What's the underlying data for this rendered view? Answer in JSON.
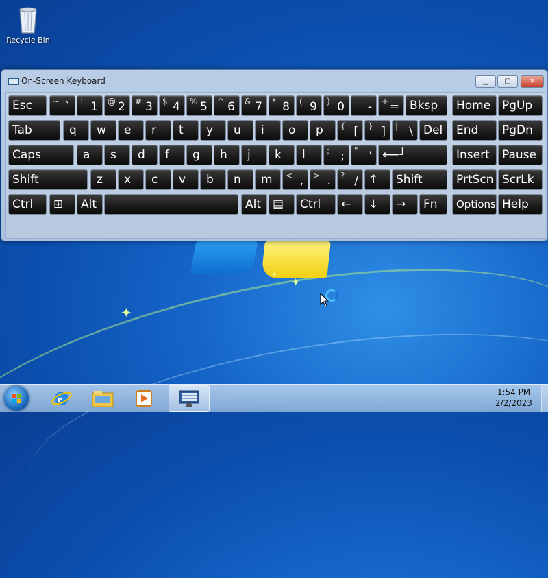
{
  "desktop": {
    "recycle_bin_label": "Recycle Bin"
  },
  "osk": {
    "title": "On-Screen Keyboard",
    "row1": [
      {
        "main": "Esc"
      },
      {
        "sym": "~",
        "ch": "`"
      },
      {
        "sym": "!",
        "ch": "1"
      },
      {
        "sym": "@",
        "ch": "2"
      },
      {
        "sym": "#",
        "ch": "3"
      },
      {
        "sym": "$",
        "ch": "4"
      },
      {
        "sym": "%",
        "ch": "5"
      },
      {
        "sym": "^",
        "ch": "6"
      },
      {
        "sym": "&",
        "ch": "7"
      },
      {
        "sym": "*",
        "ch": "8"
      },
      {
        "sym": "(",
        "ch": "9"
      },
      {
        "sym": ")",
        "ch": "0"
      },
      {
        "sym": "_",
        "ch": "-"
      },
      {
        "sym": "+",
        "ch": "="
      },
      {
        "main": "Bksp"
      },
      {
        "main": "Home"
      },
      {
        "main": "PgUp"
      }
    ],
    "row2": [
      {
        "main": "Tab"
      },
      {
        "main": "q"
      },
      {
        "main": "w"
      },
      {
        "main": "e"
      },
      {
        "main": "r"
      },
      {
        "main": "t"
      },
      {
        "main": "y"
      },
      {
        "main": "u"
      },
      {
        "main": "i"
      },
      {
        "main": "o"
      },
      {
        "main": "p"
      },
      {
        "sym": "{",
        "ch": "["
      },
      {
        "sym": "}",
        "ch": "]"
      },
      {
        "sym": "|",
        "ch": "\\"
      },
      {
        "main": "Del"
      },
      {
        "main": "End"
      },
      {
        "main": "PgDn"
      }
    ],
    "row3": [
      {
        "main": "Caps"
      },
      {
        "main": "a"
      },
      {
        "main": "s"
      },
      {
        "main": "d"
      },
      {
        "main": "f"
      },
      {
        "main": "g"
      },
      {
        "main": "h"
      },
      {
        "main": "j"
      },
      {
        "main": "k"
      },
      {
        "main": "l"
      },
      {
        "sym": ":",
        "ch": ";"
      },
      {
        "sym": "\"",
        "ch": "'"
      },
      {
        "main": "⟵┘"
      },
      {
        "main": "Insert"
      },
      {
        "main": "Pause"
      }
    ],
    "row4": [
      {
        "main": "Shift"
      },
      {
        "main": "z"
      },
      {
        "main": "x"
      },
      {
        "main": "c"
      },
      {
        "main": "v"
      },
      {
        "main": "b"
      },
      {
        "main": "n"
      },
      {
        "main": "m"
      },
      {
        "sym": "<",
        "ch": ","
      },
      {
        "sym": ">",
        "ch": "."
      },
      {
        "sym": "?",
        "ch": "/"
      },
      {
        "main": "↑"
      },
      {
        "main": "Shift"
      },
      {
        "main": "PrtScn"
      },
      {
        "main": "ScrLk"
      }
    ],
    "row5": [
      {
        "main": "Ctrl"
      },
      {
        "main": "⊞"
      },
      {
        "main": "Alt"
      },
      {
        "main": ""
      },
      {
        "main": "Alt"
      },
      {
        "main": "▤"
      },
      {
        "main": "Ctrl"
      },
      {
        "main": "←"
      },
      {
        "main": "↓"
      },
      {
        "main": "→"
      },
      {
        "main": "Fn"
      },
      {
        "main": "Options"
      },
      {
        "main": "Help"
      }
    ]
  },
  "taskbar": {
    "time": "1:54 PM",
    "date": "2/2/2023"
  }
}
